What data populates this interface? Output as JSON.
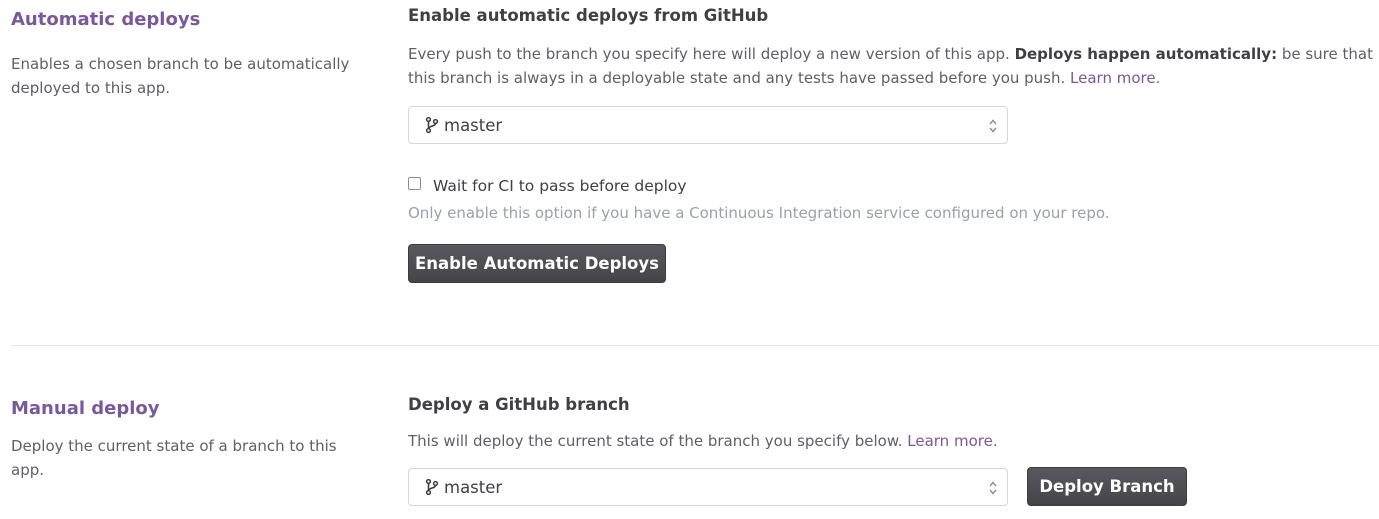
{
  "automatic": {
    "title": "Automatic deploys",
    "description": "Enables a chosen branch to be automatically deployed to this app.",
    "heading": "Enable automatic deploys from GitHub",
    "help_prefix": "Every push to the branch you specify here will deploy a new version of this app. ",
    "help_bold": "Deploys happen automatically:",
    "help_suffix": " be sure that this branch is always in a deployable state and any tests have passed before you push. ",
    "learn_more": "Learn more.",
    "branch": "master",
    "ci_label": "Wait for CI to pass before deploy",
    "ci_checked": false,
    "ci_note": "Only enable this option if you have a Continuous Integration service configured on your repo.",
    "button_label": "Enable Automatic Deploys"
  },
  "manual": {
    "title": "Manual deploy",
    "description": "Deploy the current state of a branch to this app.",
    "heading": "Deploy a GitHub branch",
    "help": "This will deploy the current state of the branch you specify below. ",
    "learn_more": "Learn more.",
    "branch": "master",
    "button_label": "Deploy Branch"
  },
  "colors": {
    "accent": "#79589f",
    "button_bg": "#4e4e54",
    "muted": "#9aa0ad"
  },
  "icons": {
    "branch": "git-branch-icon",
    "select": "select-arrows-icon",
    "checkbox": "checkbox-icon"
  }
}
